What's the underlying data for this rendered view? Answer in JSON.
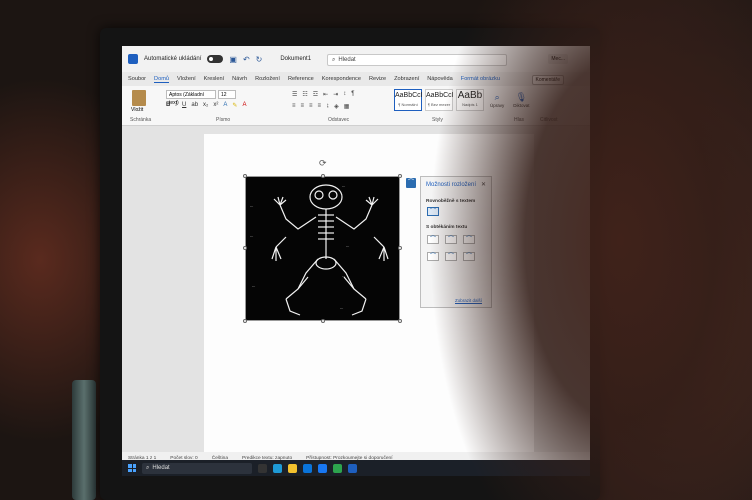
{
  "titlebar": {
    "autosave_label": "Automatické ukládání",
    "doc_name": "Dokument1",
    "search_placeholder": "Hledat",
    "user_label": "Mec..."
  },
  "tabs": [
    "Soubor",
    "Domů",
    "Vložení",
    "Kreslení",
    "Návrh",
    "Rozložení",
    "Reference",
    "Korespondence",
    "Revize",
    "Zobrazení",
    "Nápověda",
    "Formát obrázku"
  ],
  "comments_label": "Komentáře",
  "ribbon": {
    "paste_label": "Vložit",
    "clipboard_label": "Schránka",
    "font_name": "Aptos (Základní text)",
    "font_size": "12",
    "font_label": "Písmo",
    "paragraph_label": "Odstavec",
    "styles_label": "Styly",
    "styles": [
      {
        "preview": "AaBbCcI",
        "name": "¶ Normální"
      },
      {
        "preview": "AaBbCcI",
        "name": "¶ Bez mezer"
      },
      {
        "preview": "AaBb",
        "name": "Nadpis 1"
      }
    ],
    "tools": [
      {
        "label": "Úpravy",
        "icon": "search-icon"
      },
      {
        "label": "Diktovat",
        "icon": "microphone-icon"
      },
      {
        "label": "Citlivost",
        "icon": "shield-icon"
      },
      {
        "label": "Editor",
        "icon": "pen-icon"
      }
    ],
    "voice_label": "Hlas",
    "sensitivity_label": "Citlivost"
  },
  "layout_pane": {
    "title": "Možnosti rozložení",
    "section_inline": "Rovnoběžně s textem",
    "section_wrap": "S obtékáním textu",
    "see_more": "Zobrazit další"
  },
  "statusbar": {
    "page": "Stránka 1 z 1",
    "words": "Počet slov: 0",
    "language": "Čeština",
    "autosave": "Predikce textu: zapnuto",
    "accessibility": "Přístupnost: Prozkoumejte si doporučení"
  },
  "taskbar": {
    "search_label": "Hledat"
  },
  "colors": {
    "accent": "#1e5fbf",
    "taskbar": "#1b2028"
  }
}
